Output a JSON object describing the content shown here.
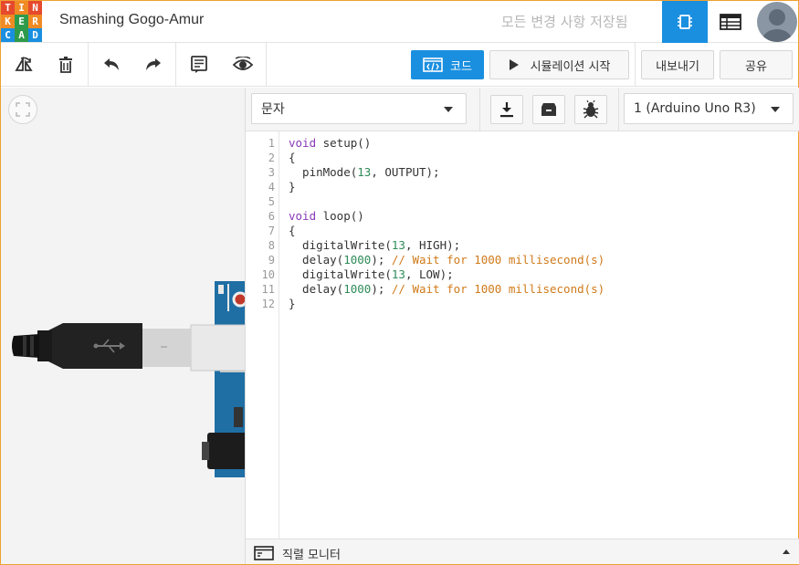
{
  "header": {
    "logo_letters": [
      "T",
      "I",
      "N",
      "K",
      "E",
      "R",
      "C",
      "A",
      "D"
    ],
    "logo_colors": [
      "#e54a2d",
      "#f08a24",
      "#e54a2d",
      "#f08a24",
      "#2f9b4a",
      "#f08a24",
      "#1a8fe0",
      "#2f9b4a",
      "#1a8fe0"
    ],
    "design_title": "Smashing Gogo-Amur",
    "save_status": "모든 변경 사항 저장됨",
    "view_buttons": [
      "chip-icon",
      "table-icon"
    ]
  },
  "toolbar": {
    "tools": [
      "rotate-icon",
      "delete-icon",
      "undo-icon",
      "redo-icon",
      "notes-icon",
      "visibility-icon"
    ],
    "code_label": "코드",
    "simulate_label": "시뮬레이션 시작",
    "export_label": "내보내기",
    "share_label": "공유"
  },
  "code_panel": {
    "mode_select": "문자",
    "device_select": "1 (Arduino Uno R3)",
    "line_numbers": [
      "1",
      "2",
      "3",
      "4",
      "5",
      "6",
      "7",
      "8",
      "9",
      "10",
      "11",
      "12"
    ],
    "serial_monitor_label": "직렬 모니터"
  },
  "code_lines": [
    [
      {
        "t": "void",
        "c": "kw"
      },
      {
        "t": " setup()",
        "c": ""
      }
    ],
    [
      {
        "t": "{",
        "c": ""
      }
    ],
    [
      {
        "t": "  pinMode(",
        "c": ""
      },
      {
        "t": "13",
        "c": "num"
      },
      {
        "t": ", OUTPUT);",
        "c": ""
      }
    ],
    [
      {
        "t": "}",
        "c": ""
      }
    ],
    [
      {
        "t": "",
        "c": ""
      }
    ],
    [
      {
        "t": "void",
        "c": "kw"
      },
      {
        "t": " loop()",
        "c": ""
      }
    ],
    [
      {
        "t": "{",
        "c": ""
      }
    ],
    [
      {
        "t": "  digitalWrite(",
        "c": ""
      },
      {
        "t": "13",
        "c": "num"
      },
      {
        "t": ", HIGH);",
        "c": ""
      }
    ],
    [
      {
        "t": "  delay(",
        "c": ""
      },
      {
        "t": "1000",
        "c": "num"
      },
      {
        "t": "); ",
        "c": ""
      },
      {
        "t": "// Wait for 1000 millisecond(s)",
        "c": "cm"
      }
    ],
    [
      {
        "t": "  digitalWrite(",
        "c": ""
      },
      {
        "t": "13",
        "c": "num"
      },
      {
        "t": ", LOW);",
        "c": ""
      }
    ],
    [
      {
        "t": "  delay(",
        "c": ""
      },
      {
        "t": "1000",
        "c": "num"
      },
      {
        "t": "); ",
        "c": ""
      },
      {
        "t": "// Wait for 1000 millisecond(s)",
        "c": "cm"
      }
    ],
    [
      {
        "t": "}",
        "c": ""
      }
    ]
  ]
}
